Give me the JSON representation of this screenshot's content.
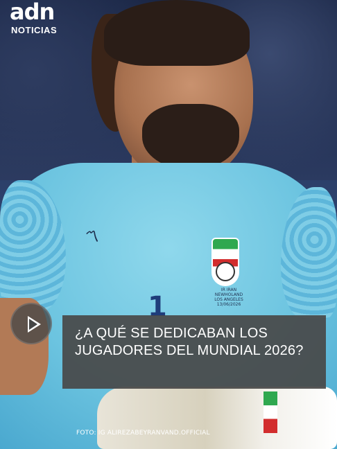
{
  "brand": {
    "logo_text": "adn",
    "logo_subtitle": "NOTICIAS"
  },
  "video": {
    "play_label": "",
    "headline": "¿A QUÉ SE DEDICABAN LOS JUGADORES DEL MUNDIAL 2026?",
    "photo_credit": "FOTO: IG ALIREZABEYRANVAND.OFFICIAL"
  },
  "photo": {
    "jersey_number": "1",
    "crest_text": "IR IRAN NEWHOLAND\nLOS ANGELES\n13/06/2026",
    "colors": {
      "jersey": "#6cc4e0",
      "card_background": "#484848",
      "play_button": "#464646"
    }
  },
  "icons": {
    "play": "play-icon"
  }
}
